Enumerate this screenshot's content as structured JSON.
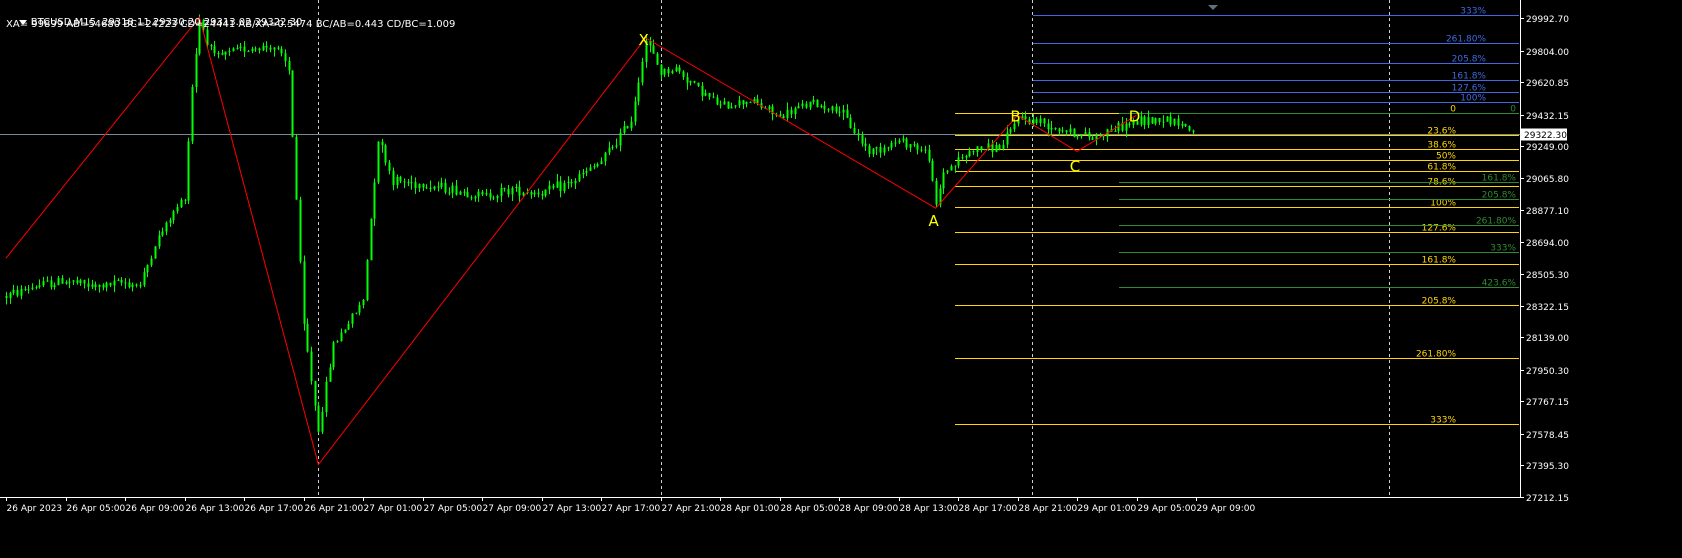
{
  "header": {
    "symbol": "BTCUSD,M15",
    "ohlc": "29318.11 29330.20 29313.02 29322.30",
    "ratios": "XA= 99899 AB=54680 BC=24223 CD=24441 AB/XA=0.5474 BC/AB=0.443 CD/BC=1.009"
  },
  "colors": {
    "background": "#000000",
    "candle": "#00ff00",
    "zigzag": "#ff0000",
    "fib_gold": "#ffd700",
    "fib_blue": "#4169e1",
    "fib_green": "#2e8b2e",
    "axis_text": "#ffffff",
    "price_line": "#778899",
    "label_yellow": "#ffff00"
  },
  "chart_data": {
    "type": "candlestick",
    "symbol": "BTCUSD",
    "timeframe": "M15",
    "ylim": [
      27212.15,
      30100
    ],
    "y_ticks": [
      "29992.70",
      "29804.00",
      "29620.85",
      "29432.15",
      "29249.00",
      "29065.80",
      "28877.10",
      "28694.00",
      "28505.30",
      "28322.15",
      "28139.00",
      "27950.30",
      "27767.15",
      "27578.45",
      "27395.30",
      "27212.15"
    ],
    "x_ticks": [
      "26 Apr 2023",
      "26 Apr 05:00",
      "26 Apr 09:00",
      "26 Apr 13:00",
      "26 Apr 17:00",
      "26 Apr 21:00",
      "27 Apr 01:00",
      "27 Apr 05:00",
      "27 Apr 09:00",
      "27 Apr 13:00",
      "27 Apr 17:00",
      "27 Apr 21:00",
      "28 Apr 01:00",
      "28 Apr 05:00",
      "28 Apr 09:00",
      "28 Apr 13:00",
      "28 Apr 17:00",
      "28 Apr 21:00",
      "29 Apr 01:00",
      "29 Apr 05:00",
      "29 Apr 09:00"
    ],
    "current_price": "29322.30",
    "price_path": [
      [
        "26 Apr 2023",
        28380
      ],
      [
        "26 Apr 03:00",
        28440
      ],
      [
        "26 Apr 05:00",
        28470
      ],
      [
        "26 Apr 07:00",
        28430
      ],
      [
        "26 Apr 09:00",
        28460
      ],
      [
        "26 Apr 10:00",
        28440
      ],
      [
        "26 Apr 11:00",
        28680
      ],
      [
        "26 Apr 12:00",
        28830
      ],
      [
        "26 Apr 13:00",
        28960
      ],
      [
        "26 Apr 13:30",
        29600
      ],
      [
        "26 Apr 14:00",
        29990
      ],
      [
        "26 Apr 15:00",
        29760
      ],
      [
        "26 Apr 17:00",
        29820
      ],
      [
        "26 Apr 19:00",
        29830
      ],
      [
        "26 Apr 20:00",
        29700
      ],
      [
        "26 Apr 21:00",
        28200
      ],
      [
        "26 Apr 22:00",
        27600
      ],
      [
        "26 Apr 23:00",
        28100
      ],
      [
        "27 Apr 01:00",
        28350
      ],
      [
        "27 Apr 02:00",
        29300
      ],
      [
        "27 Apr 03:00",
        29050
      ],
      [
        "27 Apr 05:00",
        29030
      ],
      [
        "27 Apr 07:00",
        29000
      ],
      [
        "27 Apr 09:00",
        28960
      ],
      [
        "27 Apr 11:00",
        29000
      ],
      [
        "27 Apr 13:00",
        28980
      ],
      [
        "27 Apr 15:00",
        29040
      ],
      [
        "27 Apr 17:00",
        29160
      ],
      [
        "27 Apr 19:00",
        29400
      ],
      [
        "27 Apr 20:00",
        29870
      ],
      [
        "27 Apr 21:00",
        29680
      ],
      [
        "27 Apr 22:00",
        29700
      ],
      [
        "28 Apr 01:00",
        29480
      ],
      [
        "28 Apr 03:00",
        29520
      ],
      [
        "28 Apr 05:00",
        29420
      ],
      [
        "28 Apr 07:00",
        29500
      ],
      [
        "28 Apr 09:00",
        29460
      ],
      [
        "28 Apr 11:00",
        29220
      ],
      [
        "28 Apr 13:00",
        29280
      ],
      [
        "28 Apr 14:00",
        29260
      ],
      [
        "28 Apr 15:00",
        29200
      ],
      [
        "28 Apr 15:30",
        28890
      ],
      [
        "28 Apr 16:00",
        29100
      ],
      [
        "28 Apr 18:00",
        29230
      ],
      [
        "28 Apr 20:00",
        29250
      ],
      [
        "28 Apr 21:00",
        29420
      ],
      [
        "28 Apr 23:00",
        29380
      ],
      [
        "29 Apr 01:00",
        29320
      ],
      [
        "29 Apr 02:00",
        29300
      ],
      [
        "29 Apr 03:00",
        29340
      ],
      [
        "29 Apr 05:00",
        29390
      ],
      [
        "29 Apr 07:00",
        29415
      ],
      [
        "29 Apr 08:00",
        29380
      ],
      [
        "29 Apr 09:00",
        29322
      ]
    ],
    "pattern_points": [
      {
        "label": "",
        "date": "26 Apr 2023",
        "price": 28600
      },
      {
        "label": "",
        "date": "26 Apr 14:00",
        "price": 30000
      },
      {
        "label": "",
        "date": "26 Apr 22:00",
        "price": 27400
      },
      {
        "label": "X",
        "date": "27 Apr 20:00",
        "price": 29880
      },
      {
        "label": "A",
        "date": "28 Apr 15:30",
        "price": 28890
      },
      {
        "label": "B",
        "date": "28 Apr 21:00",
        "price": 29430
      },
      {
        "label": "C",
        "date": "29 Apr 01:00",
        "price": 29220
      },
      {
        "label": "D",
        "date": "29 Apr 05:00",
        "price": 29430
      }
    ],
    "fib_gold": {
      "levels": [
        {
          "label": "0",
          "price": 29444
        },
        {
          "label": "23.6%",
          "price": 29316
        },
        {
          "label": "38.6%",
          "price": 29235
        },
        {
          "label": "50%",
          "price": 29172
        },
        {
          "label": "61.8%",
          "price": 29108
        },
        {
          "label": "78.6%",
          "price": 29018
        },
        {
          "label": "100%",
          "price": 28900
        },
        {
          "label": "127.6%",
          "price": 28750
        },
        {
          "label": "161.8%",
          "price": 28565
        },
        {
          "label": "205.8%",
          "price": 28327
        },
        {
          "label": "261.80%",
          "price": 28022
        },
        {
          "label": "333%",
          "price": 27638
        }
      ]
    },
    "fib_blue": {
      "levels": [
        {
          "label": "333%",
          "price": 30010
        },
        {
          "label": "261.80%",
          "price": 29850
        },
        {
          "label": "205.8%",
          "price": 29733
        },
        {
          "label": "161.8%",
          "price": 29637
        },
        {
          "label": "127.6%",
          "price": 29563
        },
        {
          "label": "100%",
          "price": 29505
        }
      ]
    },
    "fib_green": {
      "levels": [
        {
          "label": "0",
          "price": 29442
        },
        {
          "label": "161.8%",
          "price": 29040
        },
        {
          "label": "205.8%",
          "price": 28942
        },
        {
          "label": "261.80%",
          "price": 28795
        },
        {
          "label": "333%",
          "price": 28638
        },
        {
          "label": "423.6%",
          "price": 28433
        }
      ]
    }
  }
}
